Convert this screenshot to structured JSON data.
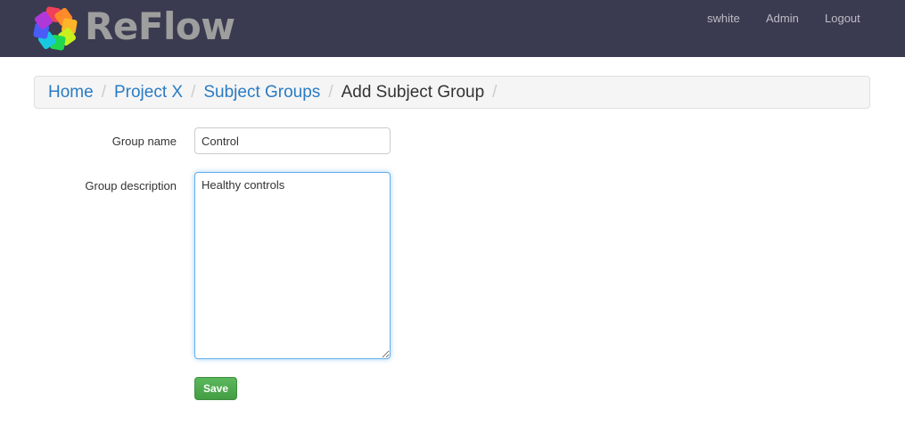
{
  "nav": {
    "brand": "ReFlow",
    "links": [
      "swhite",
      "Admin",
      "Logout"
    ],
    "logo_colors": [
      "#f0405a",
      "#ff8a2a",
      "#ffb52a",
      "#c8f01e",
      "#20d850",
      "#18c8e0",
      "#4a5cf8",
      "#b038d8"
    ]
  },
  "breadcrumb": {
    "items": [
      "Home",
      "Project X",
      "Subject Groups"
    ],
    "current": "Add Subject Group",
    "sep": "/"
  },
  "form": {
    "name_label": "Group name",
    "name_value": "Control",
    "desc_label": "Group description",
    "desc_value": "Healthy controls",
    "save_label": "Save"
  }
}
